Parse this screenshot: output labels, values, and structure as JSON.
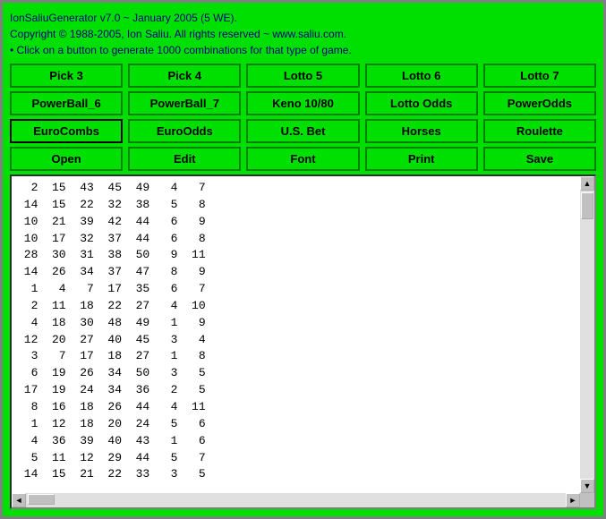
{
  "header": {
    "line1": "IonSaliuGenerator v7.0 ~ January 2005 (5 WE).",
    "line2": "Copyright © 1988-2005, Ion Saliu. All rights reserved ~ www.saliu.com.",
    "line3": "• Click on a button to generate 1000 combinations for that type of game."
  },
  "buttons_row1": [
    {
      "label": "Pick 3",
      "name": "pick3-button"
    },
    {
      "label": "Pick 4",
      "name": "pick4-button"
    },
    {
      "label": "Lotto 5",
      "name": "lotto5-button"
    },
    {
      "label": "Lotto 6",
      "name": "lotto6-button"
    },
    {
      "label": "Lotto 7",
      "name": "lotto7-button"
    }
  ],
  "buttons_row2": [
    {
      "label": "PowerBall_6",
      "name": "powerball6-button"
    },
    {
      "label": "PowerBall_7",
      "name": "powerball7-button"
    },
    {
      "label": "Keno 10/80",
      "name": "keno-button"
    },
    {
      "label": "Lotto Odds",
      "name": "lottoodds-button"
    },
    {
      "label": "PowerOdds",
      "name": "powerodds-button"
    }
  ],
  "buttons_row3": [
    {
      "label": "EuroCombs",
      "name": "eurocombs-button",
      "selected": true
    },
    {
      "label": "EuroOdds",
      "name": "euroodds-button"
    },
    {
      "label": "U.S. Bet",
      "name": "usbet-button"
    },
    {
      "label": "Horses",
      "name": "horses-button"
    },
    {
      "label": "Roulette",
      "name": "roulette-button"
    }
  ],
  "buttons_row4": [
    {
      "label": "Open",
      "name": "open-button"
    },
    {
      "label": "Edit",
      "name": "edit-button"
    },
    {
      "label": "Font",
      "name": "font-button"
    },
    {
      "label": "Print",
      "name": "print-button"
    },
    {
      "label": "Save",
      "name": "save-button"
    }
  ],
  "data_content": "  2  15  43  45  49   4   7\n 14  15  22  32  38   5   8\n 10  21  39  42  44   6   9\n 10  17  32  37  44   6   8\n 28  30  31  38  50   9  11\n 14  26  34  37  47   8   9\n  1   4   7  17  35   6   7\n  2  11  18  22  27   4  10\n  4  18  30  48  49   1   9\n 12  20  27  40  45   3   4\n  3   7  17  18  27   1   8\n  6  19  26  34  50   3   5\n 17  19  24  34  36   2   5\n  8  16  18  26  44   4  11\n  1  12  18  20  24   5   6\n  4  36  39  40  43   1   6\n  5  11  12  29  44   5   7\n 14  15  21  22  33   3   5"
}
